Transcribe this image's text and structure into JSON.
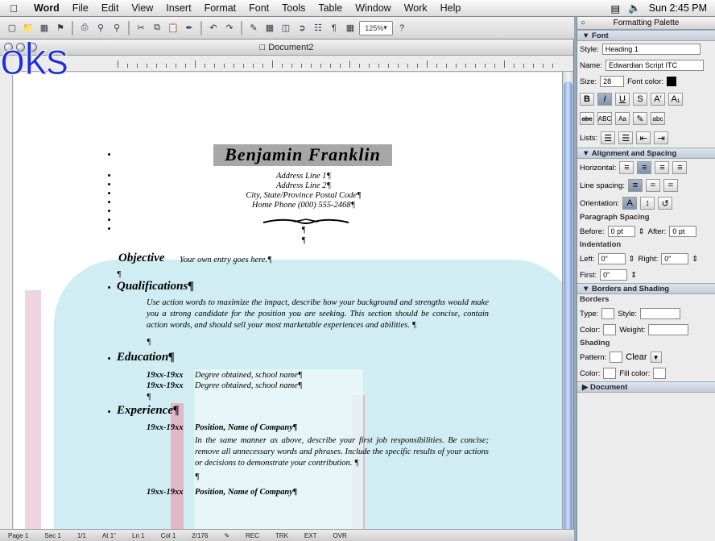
{
  "menubar": {
    "app": "Word",
    "items": [
      "File",
      "Edit",
      "View",
      "Insert",
      "Format",
      "Font",
      "Tools",
      "Table",
      "Window",
      "Work",
      "Help"
    ],
    "clock": "Sun 2:45 PM"
  },
  "toolbar": {
    "zoom": "125%"
  },
  "window": {
    "title": "Document2"
  },
  "overlay_text": "oks",
  "resume": {
    "name": "Benjamin Franklin",
    "address": [
      "Address Line 1¶",
      "Address Line 2¶",
      "City, State/Province Postal Code¶",
      "Home Phone (000) 555-2468¶"
    ],
    "pilcrow": "¶",
    "objective_head": "Objective",
    "objective_text": "Your own entry goes here.¶",
    "qual_head": "Qualifications¶",
    "qual_text": "Use action words to maximize the impact, describe how your background and strengths would make you a strong candidate for the position you are seeking. This section should be concise, contain action words, and should sell your most marketable experiences and abilities. ¶",
    "edu_head": "Education¶",
    "edu": [
      {
        "years": "19xx-19xx",
        "text": "Degree obtained, school name¶"
      },
      {
        "years": "19xx-19xx",
        "text": "Degree obtained, school name¶"
      }
    ],
    "exp_head": "Experience¶",
    "exp1_years": "19xx-19xx",
    "exp1_title": "Position, Name of Company¶",
    "exp1_text": "In the same manner as above, describe your first job responsibilities. Be concise; remove all unnecessary words and phrases. Include the specific results of your actions or decisions to demonstrate your contribution. ¶",
    "exp2_years": "19xx-19xx",
    "exp2_title": "Position, Name of Company¶"
  },
  "status": [
    "Page 1",
    "Sec 1",
    "1/1",
    "At 1\"",
    "Ln 1",
    "Col 1",
    "2/176",
    "REC",
    "TRK",
    "EXT",
    "OVR"
  ],
  "palette": {
    "title": "Formatting Palette",
    "font_section": "Font",
    "style_label": "Style:",
    "style_value": "Heading 1",
    "name_label": "Name:",
    "name_value": "Edwardian Script ITC",
    "size_label": "Size:",
    "size_value": "28",
    "font_color_label": "Font color:",
    "lists_label": "Lists:",
    "align_section": "Alignment and Spacing",
    "horizontal_label": "Horizontal:",
    "line_spacing_label": "Line spacing:",
    "orientation_label": "Orientation:",
    "para_spacing_label": "Paragraph Spacing",
    "before_label": "Before:",
    "before_value": "0 pt",
    "after_label": "After:",
    "after_value": "0 pt",
    "indent_label": "Indentation",
    "left_label": "Left:",
    "left_value": "0\"",
    "right_label": "Right:",
    "right_value": "0\"",
    "first_label": "First:",
    "first_value": "0\"",
    "borders_section": "Borders and Shading",
    "borders_label": "Borders",
    "type_label": "Type:",
    "style2_label": "Style:",
    "color_label": "Color:",
    "weight_label": "Weight:",
    "shading_label": "Shading",
    "pattern_label": "Pattern:",
    "pattern_value": "Clear",
    "color2_label": "Color:",
    "fill_label": "Fill color:",
    "document_section": "Document"
  }
}
